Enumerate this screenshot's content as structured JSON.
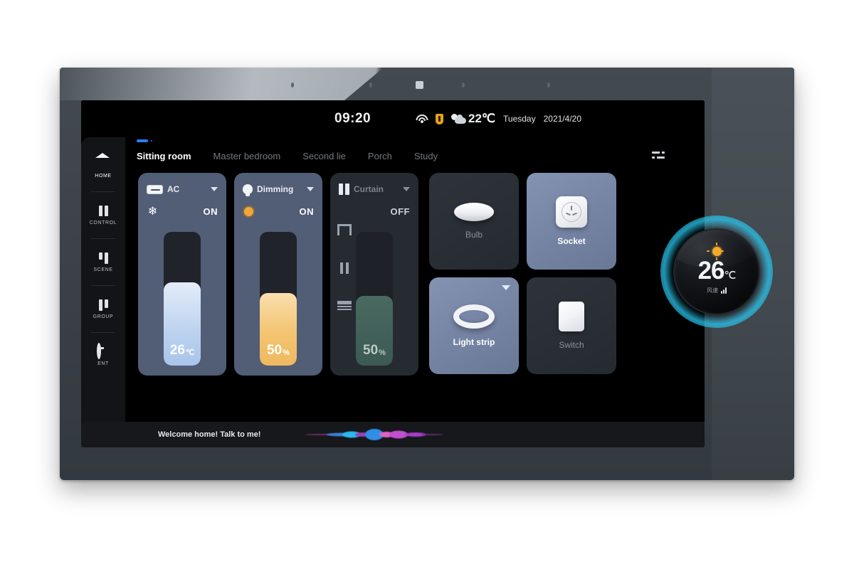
{
  "status_bar": {
    "time": "09:20",
    "wifi_icon": "wifi-icon",
    "alert_icon": "alert-icon",
    "weather_icon": "sun-behind-cloud-icon",
    "outdoor_temp": "22℃",
    "weekday": "Tuesday",
    "date": "2021/4/20"
  },
  "sidebar": {
    "items": [
      {
        "label": "HOME",
        "icon": "home-icon",
        "active": true
      },
      {
        "label": "CONTROL",
        "icon": "sliders-icon",
        "active": false
      },
      {
        "label": "SCENE",
        "icon": "scene-icon",
        "active": false
      },
      {
        "label": "GROUP",
        "icon": "group-icon",
        "active": false
      },
      {
        "label": "ENT",
        "icon": "entertainment-icon",
        "active": false
      }
    ]
  },
  "tabs": [
    {
      "label": "Sitting room",
      "active": true
    },
    {
      "label": "Master bedroom",
      "active": false
    },
    {
      "label": "Second lie",
      "active": false
    },
    {
      "label": "Porch",
      "active": false
    },
    {
      "label": "Study",
      "active": false
    }
  ],
  "filter_icon": "settings-sliders-icon",
  "cards": {
    "ac": {
      "title": "AC",
      "icon": "air-conditioner-icon",
      "mode_icon": "snowflake-icon",
      "power_state": "ON",
      "value": "26",
      "unit": "℃",
      "fill_percent": 62
    },
    "dimming": {
      "title": "Dimming",
      "icon": "bulb-icon",
      "mode_icon": "brightness-circle-icon",
      "power_state": "ON",
      "value": "50",
      "unit": "%",
      "fill_percent": 54
    },
    "curtain": {
      "title": "Curtain",
      "icon": "curtain-icon",
      "power_state": "OFF",
      "value": "50",
      "unit": "%",
      "fill_percent": 52,
      "controls": [
        "curtain-open-icon",
        "curtain-pause-icon",
        "curtain-close-icon"
      ]
    }
  },
  "tiles": [
    {
      "label": "Bulb",
      "icon": "ceiling-light-icon",
      "state": "off",
      "has_chevron": false
    },
    {
      "label": "Socket",
      "icon": "power-socket-icon",
      "state": "on",
      "has_chevron": false
    },
    {
      "label": "Light strip",
      "icon": "light-ring-icon",
      "state": "on",
      "has_chevron": true
    },
    {
      "label": "Switch",
      "icon": "wall-switch-icon",
      "state": "off",
      "has_chevron": false
    }
  ],
  "voice_bar": {
    "text": "Welcome home! Talk to me!",
    "waveform_icon": "voice-waveform-icon"
  },
  "knob": {
    "sun_icon": "sun-icon",
    "temp": "26",
    "unit": "℃",
    "sub_text": "风速",
    "signal_icon": "signal-bars-icon"
  },
  "colors": {
    "accent_blue": "#2d7df0",
    "card_on_bg": "#525d76",
    "card_off_bg": "#262a31",
    "tile_on_bg": "#7886a6",
    "amber": "#f0a73a",
    "knob_glow": "#2ac8f0"
  }
}
